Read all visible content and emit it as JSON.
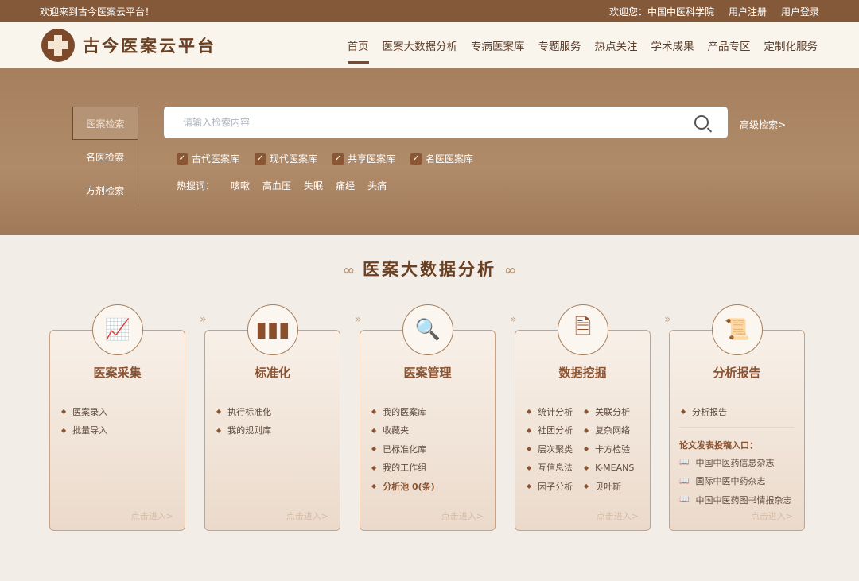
{
  "topbar": {
    "welcome": "欢迎来到古今医案云平台！",
    "user": "欢迎您：中国中医科学院",
    "register": "用户注册",
    "login": "用户登录"
  },
  "header": {
    "logo_text": "古今医案云平台",
    "nav": [
      "首页",
      "医案大数据分析",
      "专病医案库",
      "专题服务",
      "热点关注",
      "学术成果",
      "产品专区",
      "定制化服务"
    ]
  },
  "search": {
    "tabs": [
      "医案检索",
      "名医检索",
      "方剂检索"
    ],
    "placeholder": "请输入检索内容",
    "advanced": "高级检索>",
    "checkboxes": [
      "古代医案库",
      "现代医案库",
      "共享医案库",
      "名医医案库"
    ],
    "hot_label": "热搜词：",
    "hot_words": [
      "咳嗽",
      "高血压",
      "失眠",
      "痛经",
      "头痛"
    ]
  },
  "section_title": "医案大数据分析",
  "cards": [
    {
      "title": "医案采集",
      "items": [
        "医案录入",
        "批量导入"
      ],
      "enter": "点击进入>"
    },
    {
      "title": "标准化",
      "items": [
        "执行标准化",
        "我的规则库"
      ],
      "enter": "点击进入>"
    },
    {
      "title": "医案管理",
      "items": [
        "我的医案库",
        "收藏夹",
        "已标准化库",
        "我的工作组",
        "分析池 0(条)"
      ],
      "enter": "点击进入>"
    },
    {
      "title": "数据挖掘",
      "items": [
        "统计分析",
        "关联分析",
        "社团分析",
        "复杂网络",
        "层次聚类",
        "卡方检验",
        "互信息法",
        "K-MEANS",
        "因子分析",
        "贝叶斯"
      ],
      "enter": "点击进入>"
    },
    {
      "title": "分析报告",
      "items": [
        "分析报告"
      ],
      "journal_title": "论文发表投稿入口：",
      "journals": [
        "中国中医药信息杂志",
        "国际中医中药杂志",
        "中国中医药图书情报杂志"
      ],
      "enter": "点击进入>"
    }
  ]
}
